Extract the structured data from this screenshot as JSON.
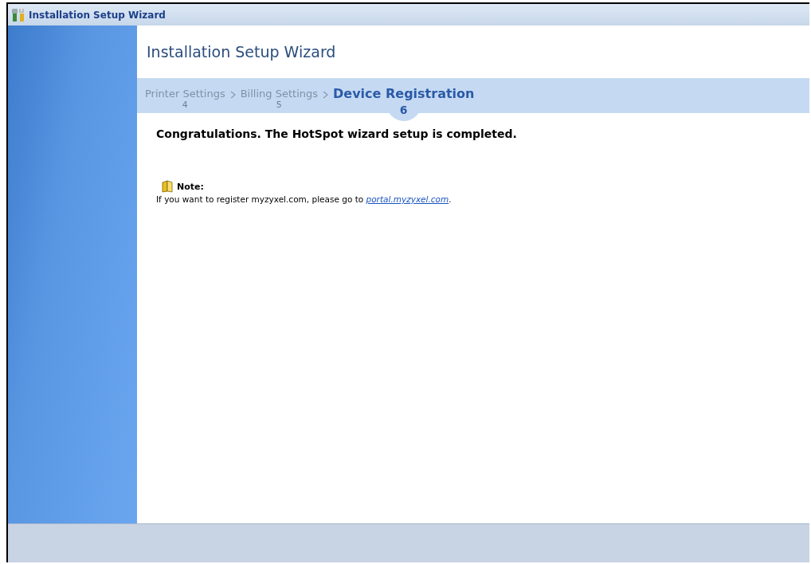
{
  "window": {
    "title": "Installation Setup Wizard"
  },
  "wizard": {
    "title": "Installation Setup Wizard",
    "steps": [
      {
        "label": "Printer Settings",
        "number": "4",
        "selected": false
      },
      {
        "label": "Billing Settings",
        "number": "5",
        "selected": false
      },
      {
        "label": "Device Registration",
        "number": "6",
        "selected": true
      }
    ],
    "message": "Congratulations. The HotSpot wizard setup is completed.",
    "note": {
      "heading": "Note:",
      "text_before": "If you want to register myzyxel.com, please go to ",
      "link": "portal.myzyxel.com",
      "text_after": "."
    }
  }
}
